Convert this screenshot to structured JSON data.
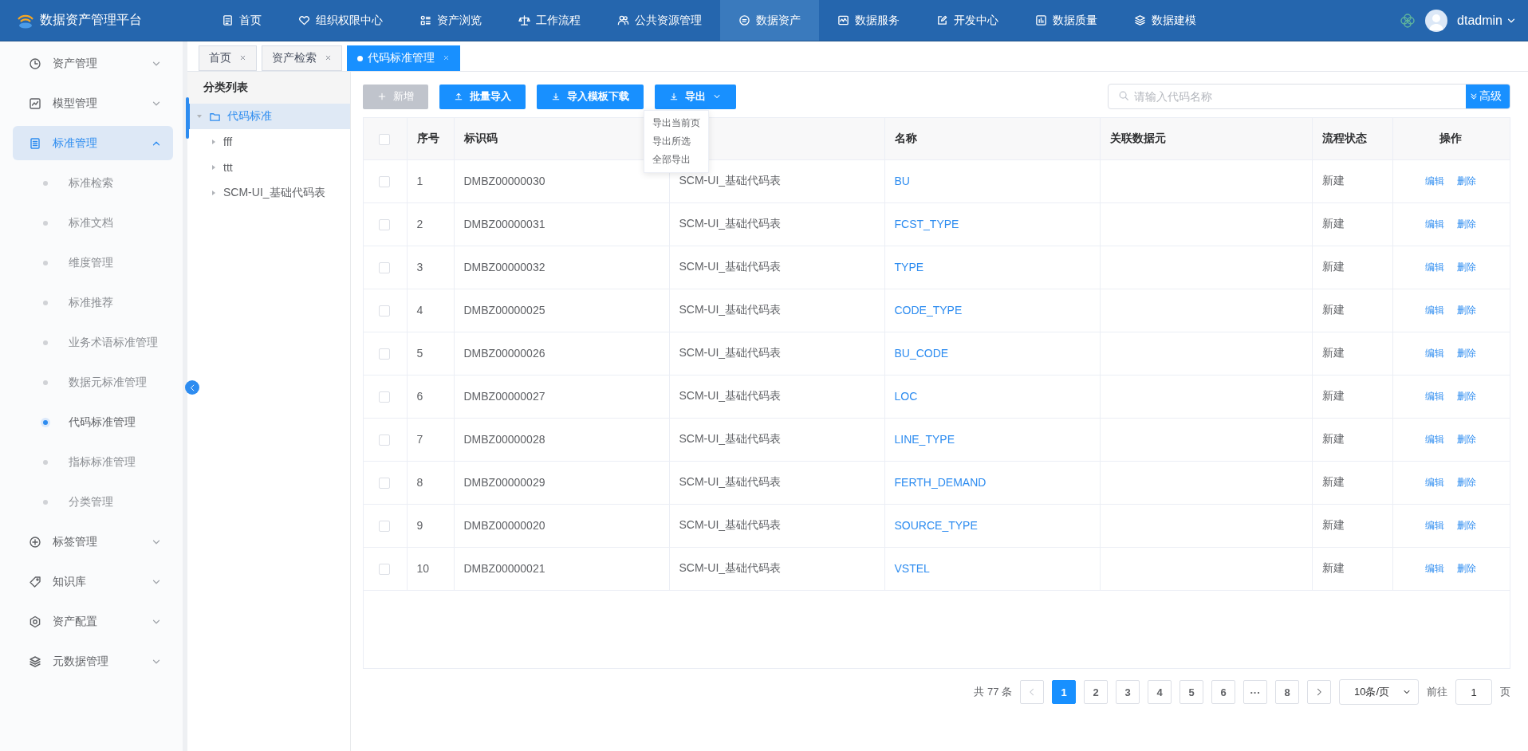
{
  "topbar": {
    "app_name": "数据资产管理平台",
    "nav": [
      {
        "label": "首页",
        "selected": false
      },
      {
        "label": "组织权限中心",
        "selected": false
      },
      {
        "label": "资产浏览",
        "selected": false
      },
      {
        "label": "工作流程",
        "selected": false
      },
      {
        "label": "公共资源管理",
        "selected": false
      },
      {
        "label": "数据资产",
        "selected": true
      },
      {
        "label": "数据服务",
        "selected": false
      },
      {
        "label": "开发中心",
        "selected": false
      },
      {
        "label": "数据质量",
        "selected": false
      },
      {
        "label": "数据建模",
        "selected": false
      }
    ],
    "user": "dtadmin"
  },
  "sidebar": {
    "items": [
      {
        "label": "资产管理",
        "expanded": false,
        "selected": false
      },
      {
        "label": "模型管理",
        "expanded": false,
        "selected": false
      },
      {
        "label": "标准管理",
        "expanded": true,
        "selected": true,
        "children": [
          {
            "label": "标准检索",
            "selected": false
          },
          {
            "label": "标准文档",
            "selected": false
          },
          {
            "label": "维度管理",
            "selected": false
          },
          {
            "label": "标准推荐",
            "selected": false
          },
          {
            "label": "业务术语标准管理",
            "selected": false
          },
          {
            "label": "数据元标准管理",
            "selected": false
          },
          {
            "label": "代码标准管理",
            "selected": true
          },
          {
            "label": "指标标准管理",
            "selected": false
          },
          {
            "label": "分类管理",
            "selected": false
          }
        ]
      },
      {
        "label": "标签管理",
        "expanded": false,
        "selected": false
      },
      {
        "label": "知识库",
        "expanded": false,
        "selected": false
      },
      {
        "label": "资产配置",
        "expanded": false,
        "selected": false
      },
      {
        "label": "元数据管理",
        "expanded": false,
        "selected": false
      }
    ]
  },
  "tabs": [
    {
      "label": "首页",
      "selected": false
    },
    {
      "label": "资产检索",
      "selected": false
    },
    {
      "label": "代码标准管理",
      "selected": true
    }
  ],
  "tree": {
    "title": "分类列表",
    "nodes": [
      {
        "label": "代码标准",
        "expanded": true,
        "selected": true,
        "children": [
          {
            "label": "fff",
            "expanded": false,
            "selected": false
          },
          {
            "label": "ttt",
            "expanded": false,
            "selected": false
          },
          {
            "label": "SCM-UI_基础代码表",
            "expanded": false,
            "selected": false
          }
        ]
      }
    ]
  },
  "toolbar": {
    "buttons": [
      {
        "label": "新增",
        "kind": "add",
        "disabled": true
      },
      {
        "label": "批量导入",
        "kind": "upload",
        "disabled": false
      },
      {
        "label": "导入模板下载",
        "kind": "download",
        "disabled": false
      },
      {
        "label": "导出",
        "kind": "dropdown",
        "disabled": false
      }
    ],
    "export_menu": [
      "导出当前页",
      "导出所选",
      "全部导出"
    ],
    "search": {
      "placeholder": "请输入代码名称"
    },
    "advanced": "高级"
  },
  "table": {
    "all_checked": false,
    "columns": [
      "序号",
      "标识码",
      "",
      "名称",
      "关联数据元",
      "流程状态",
      "操作"
    ],
    "rows": [
      {
        "checked": false,
        "index": "1",
        "code": "DMBZ00000030",
        "category": "SCM-UI_基础代码表",
        "name": "BU",
        "status": "新建",
        "actions": [
          "编辑",
          "删除"
        ]
      },
      {
        "checked": false,
        "index": "2",
        "code": "DMBZ00000031",
        "category": "SCM-UI_基础代码表",
        "name": "FCST_TYPE",
        "status": "新建",
        "actions": [
          "编辑",
          "删除"
        ]
      },
      {
        "checked": false,
        "index": "3",
        "code": "DMBZ00000032",
        "category": "SCM-UI_基础代码表",
        "name": "TYPE",
        "status": "新建",
        "actions": [
          "编辑",
          "删除"
        ]
      },
      {
        "checked": false,
        "index": "4",
        "code": "DMBZ00000025",
        "category": "SCM-UI_基础代码表",
        "name": "CODE_TYPE",
        "status": "新建",
        "actions": [
          "编辑",
          "删除"
        ]
      },
      {
        "checked": false,
        "index": "5",
        "code": "DMBZ00000026",
        "category": "SCM-UI_基础代码表",
        "name": "BU_CODE",
        "status": "新建",
        "actions": [
          "编辑",
          "删除"
        ]
      },
      {
        "checked": false,
        "index": "6",
        "code": "DMBZ00000027",
        "category": "SCM-UI_基础代码表",
        "name": "LOC",
        "status": "新建",
        "actions": [
          "编辑",
          "删除"
        ]
      },
      {
        "checked": false,
        "index": "7",
        "code": "DMBZ00000028",
        "category": "SCM-UI_基础代码表",
        "name": "LINE_TYPE",
        "status": "新建",
        "actions": [
          "编辑",
          "删除"
        ]
      },
      {
        "checked": false,
        "index": "8",
        "code": "DMBZ00000029",
        "category": "SCM-UI_基础代码表",
        "name": "FERTH_DEMAND",
        "status": "新建",
        "actions": [
          "编辑",
          "删除"
        ]
      },
      {
        "checked": false,
        "index": "9",
        "code": "DMBZ00000020",
        "category": "SCM-UI_基础代码表",
        "name": "SOURCE_TYPE",
        "status": "新建",
        "actions": [
          "编辑",
          "删除"
        ]
      },
      {
        "checked": false,
        "index": "10",
        "code": "DMBZ00000021",
        "category": "SCM-UI_基础代码表",
        "name": "VSTEL",
        "status": "新建",
        "actions": [
          "编辑",
          "删除"
        ]
      }
    ]
  },
  "pagination": {
    "total": "共 77 条",
    "pages": [
      {
        "label": "1",
        "selected": true
      },
      {
        "label": "2",
        "selected": false
      },
      {
        "label": "3",
        "selected": false
      },
      {
        "label": "4",
        "selected": false
      },
      {
        "label": "5",
        "selected": false
      },
      {
        "label": "6",
        "selected": false
      },
      {
        "label": "···",
        "selected": false
      },
      {
        "label": "8",
        "selected": false
      }
    ],
    "page_size": "10条/页",
    "goto_label": "前往",
    "goto_value": "1",
    "goto_suffix": "页"
  }
}
